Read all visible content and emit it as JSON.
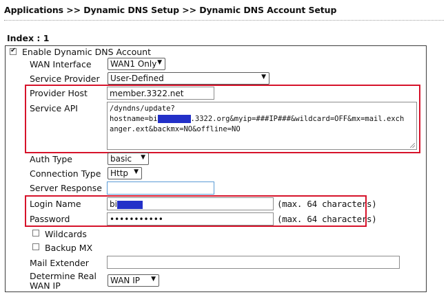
{
  "breadcrumb": {
    "parts": [
      "Applications",
      "Dynamic DNS Setup",
      "Dynamic DNS Account Setup"
    ],
    "separator": ">>",
    "text": "Applications >> Dynamic DNS Setup >> Dynamic DNS Account Setup"
  },
  "index_label": "Index : 1",
  "enable": {
    "label": "Enable Dynamic DNS Account",
    "checked": true
  },
  "wan_interface": {
    "label": "WAN Interface",
    "value": "WAN1 Only"
  },
  "service_provider": {
    "label": "Service Provider",
    "value": "User-Defined"
  },
  "provider_host": {
    "label": "Provider Host",
    "value": "member.3322.net"
  },
  "service_api": {
    "label": "Service API",
    "line1": "/dyndns/update?",
    "line2_prefix": "hostname=bi",
    "line2_suffix": ".3322.org&myip=###IP###&wildcard=OFF&mx=mail.exch",
    "line3": "anger.ext&backmx=NO&offline=NO"
  },
  "auth_type": {
    "label": "Auth Type",
    "value": "basic"
  },
  "connection_type": {
    "label": "Connection Type",
    "value": "Http"
  },
  "server_response": {
    "label": "Server Response",
    "value": ""
  },
  "login_name": {
    "label": "Login Name",
    "value_prefix": "bi",
    "hint": "(max. 64 characters)"
  },
  "password": {
    "label": "Password",
    "value": "•••••••••••",
    "hint": "(max. 64 characters)"
  },
  "wildcards": {
    "label": "Wildcards",
    "checked": false
  },
  "backup_mx": {
    "label": "Backup MX",
    "checked": false
  },
  "mail_extender": {
    "label": "Mail Extender",
    "value": ""
  },
  "determine_real_wan_ip": {
    "label_line1": "Determine Real",
    "label_line2": "WAN IP",
    "value": "WAN IP"
  },
  "colors": {
    "highlight": "#d6122a",
    "redaction": "#2330c8"
  },
  "icons": {
    "dropdown": "down-triangle",
    "checkbox_checked": "check-mark"
  }
}
